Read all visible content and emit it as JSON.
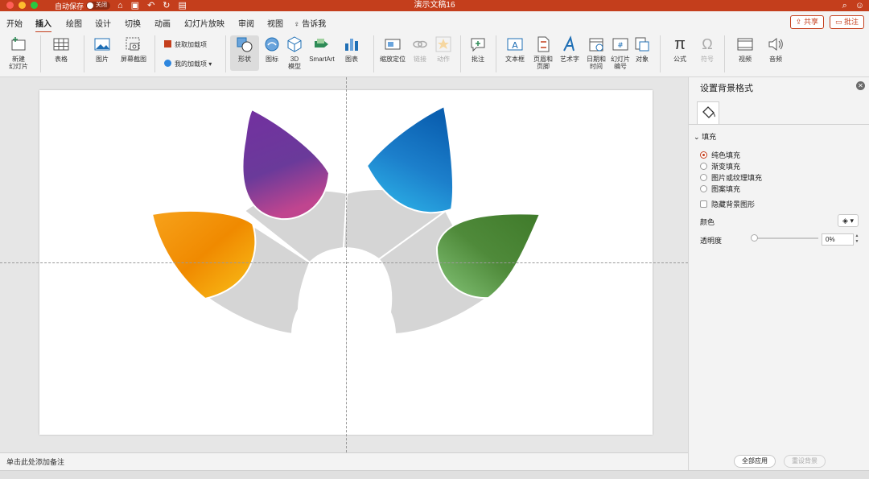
{
  "window": {
    "autosave_label": "自动保存",
    "autosave_state": "关闭",
    "title": "演示文稿16"
  },
  "menu": {
    "tabs": [
      "开始",
      "插入",
      "绘图",
      "设计",
      "切换",
      "动画",
      "幻灯片放映",
      "审阅",
      "视图",
      "告诉我"
    ],
    "active_tab": "插入",
    "share_label": "共享",
    "comment_label": "批注"
  },
  "ribbon": {
    "new_slide": "新建\n幻灯片",
    "table": "表格",
    "picture": "图片",
    "screenshot": "屏幕截图",
    "get_addins": "获取加载项",
    "my_addins": "我的加载项",
    "shapes": "形状",
    "icons": "图标",
    "model_3d": "3D\n模型",
    "smartart": "SmartArt",
    "chart": "图表",
    "zoom": "缩放定位",
    "link": "链接",
    "action": "动作",
    "comment": "批注",
    "textbox": "文本框",
    "header_footer": "页眉和\n页脚",
    "wordart": "艺术字",
    "date_time": "日期和\n时间",
    "slide_number": "幻灯片\n编号",
    "object": "对象",
    "equation": "公式",
    "symbol": "符号",
    "video": "视频",
    "audio": "音频"
  },
  "notes_placeholder": "单击此处添加备注",
  "pane": {
    "title": "设置背景格式",
    "section": "填充",
    "options": [
      "纯色填充",
      "渐变填充",
      "图片或纹理填充",
      "图案填充"
    ],
    "selected_option": "纯色填充",
    "hide_bg_graphics": "隐藏背景图形",
    "color_label": "颜色",
    "transparency_label": "透明度",
    "transparency_value": "0%",
    "transparency_fraction": 0,
    "apply_all": "全部应用",
    "reset_bg": "重设背景"
  },
  "colors": {
    "accent": "#c43e1c",
    "petal_orange": "#f39c12",
    "petal_purple": "#7a3aa0",
    "petal_blue": "#1877c5",
    "petal_green": "#5a9a46",
    "arc_gray": "#d4d4d4"
  }
}
